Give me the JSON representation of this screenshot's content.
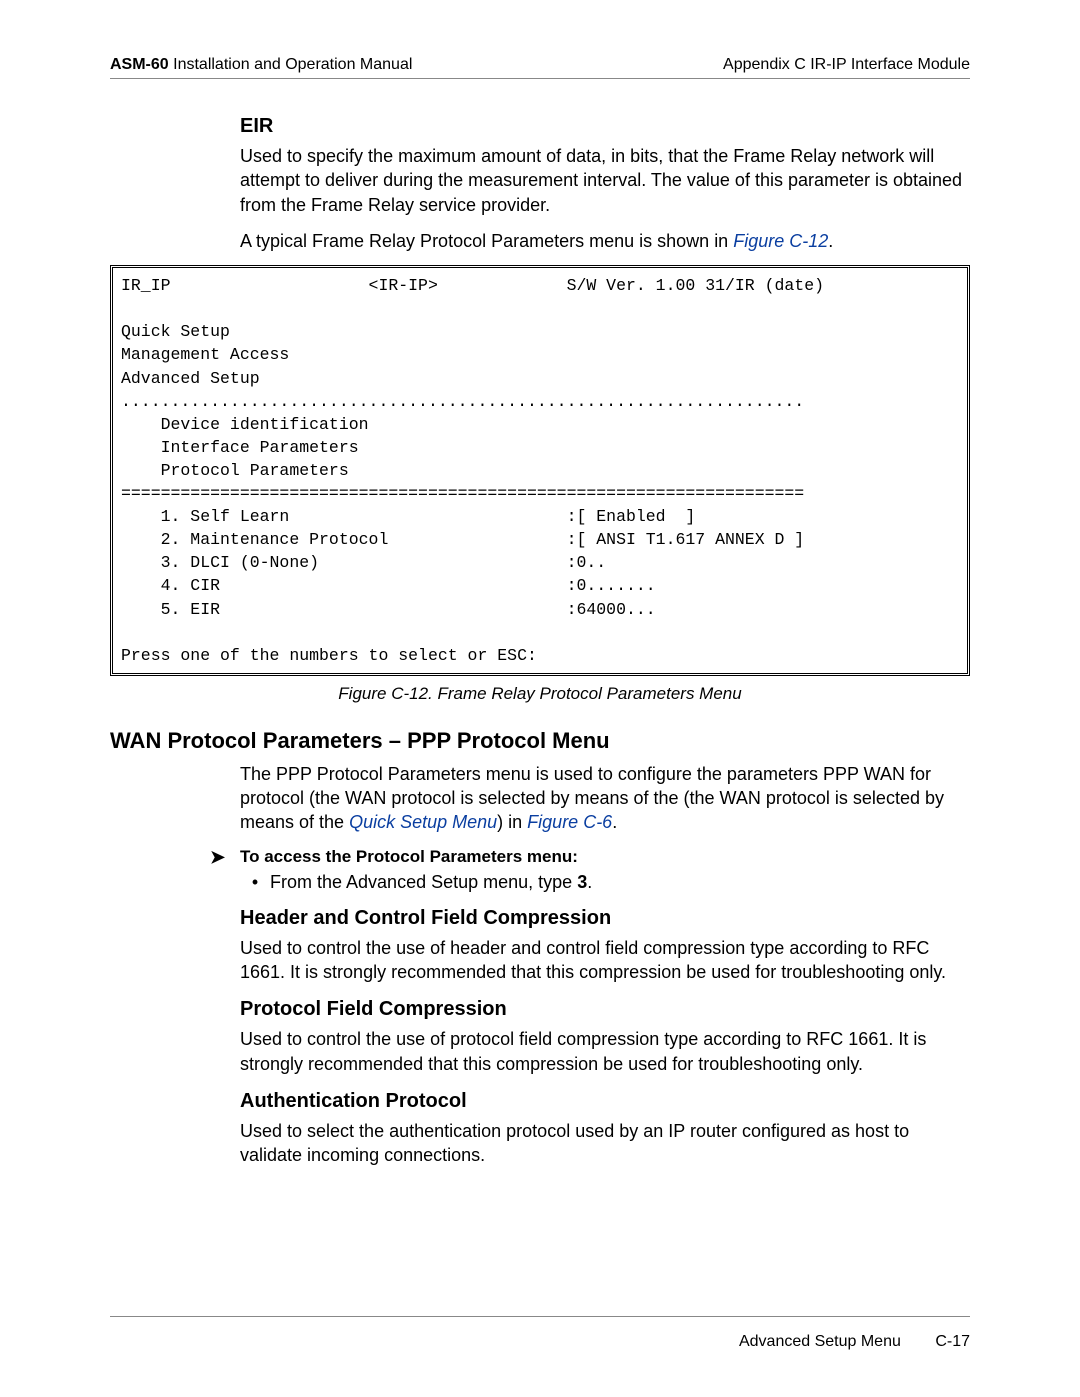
{
  "header": {
    "product": "ASM-60",
    "title": " Installation and Operation Manual",
    "right": "Appendix C  IR-IP Interface Module"
  },
  "eir": {
    "heading": "EIR",
    "para1": "Used to specify the maximum amount of data, in bits, that the Frame Relay network will attempt to deliver during the measurement interval. The value of this parameter is obtained from the Frame Relay service provider.",
    "para2_pre": "A typical Frame Relay Protocol Parameters menu is shown in ",
    "para2_link": "Figure C-12",
    "para2_post": "."
  },
  "terminal": {
    "line1_left": "IR_IP",
    "line1_mid": "<IR-IP>",
    "line1_right": "S/W Ver. 1.00 31/IR (date)",
    "quick": "Quick Setup",
    "mgmt": "Management Access",
    "adv": "Advanced Setup",
    "dots": ".....................................................................",
    "devid": "    Device identification",
    "ifparams": "    Interface Parameters",
    "protparams": "    Protocol Parameters",
    "eqline": "=====================================================================",
    "row1_l": "    1. Self Learn",
    "row1_r": ":[ Enabled  ]",
    "row2_l": "    2. Maintenance Protocol",
    "row2_r": ":[ ANSI T1.617 ANNEX D ]",
    "row3_l": "    3. DLCI (0-None)",
    "row3_r": ":0..",
    "row4_l": "    4. CIR",
    "row4_r": ":0.......",
    "row5_l": "    5. EIR",
    "row5_r": ":64000...",
    "prompt": "Press one of the numbers to select or ESC:"
  },
  "figcap": "Figure C-12.  Frame Relay Protocol Parameters Menu",
  "wan": {
    "heading": "WAN Protocol Parameters – PPP Protocol Menu",
    "para_pre": "The PPP Protocol Parameters menu is used to configure the parameters PPP WAN for protocol (the WAN protocol is selected by means of the (the WAN protocol is selected by means of the ",
    "para_link1": "Quick Setup Menu",
    "para_mid": ") in ",
    "para_link2": "Figure C-6",
    "para_post": ".",
    "proc_title": "To access the Protocol Parameters menu:",
    "bullet_pre": "From the Advanced Setup menu, type ",
    "bullet_bold": "3",
    "bullet_post": "."
  },
  "hcfc": {
    "heading": "Header and Control Field Compression",
    "para": "Used to control the use of header and control field compression type according to RFC 1661. It is strongly recommended that this compression be used for troubleshooting only."
  },
  "pfc": {
    "heading": "Protocol Field Compression",
    "para": "Used to control the use of protocol field compression type according to RFC 1661. It is strongly recommended that this compression be used for troubleshooting only."
  },
  "auth": {
    "heading": "Authentication Protocol",
    "para": "Used to select the authentication protocol used by an IP router configured as host to validate incoming connections."
  },
  "footer": {
    "label": "Advanced Setup Menu",
    "pageno": "C-17"
  }
}
